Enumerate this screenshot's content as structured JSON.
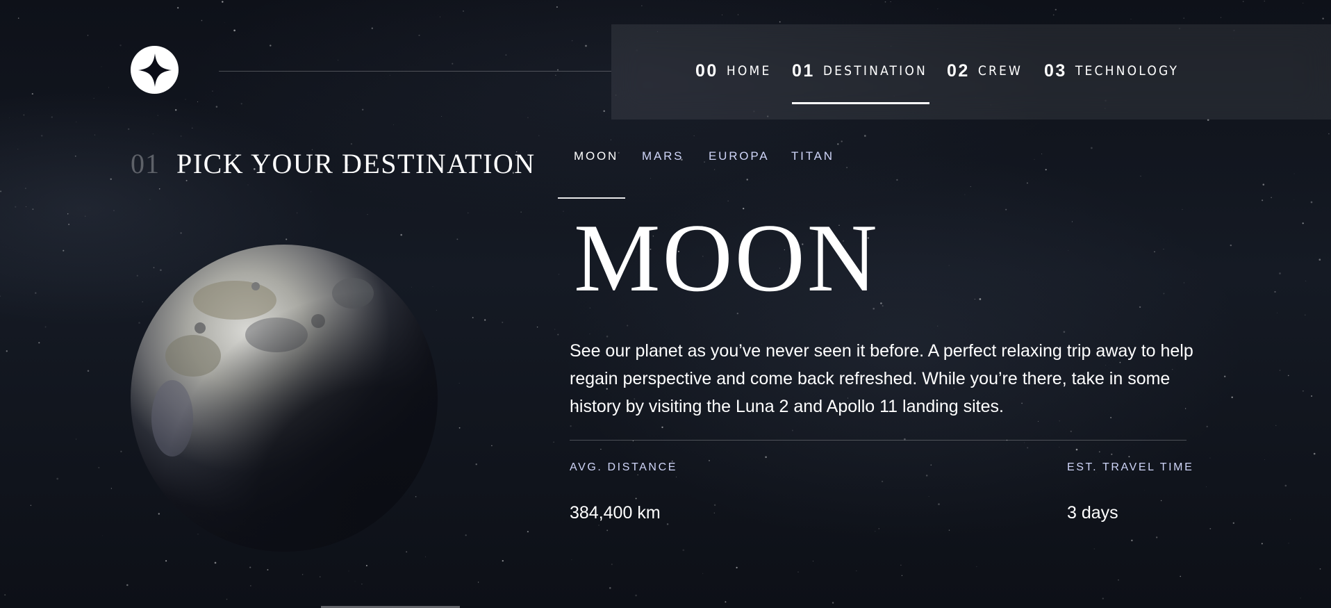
{
  "nav": {
    "items": [
      {
        "num": "00",
        "label": "HOME"
      },
      {
        "num": "01",
        "label": "DESTINATION"
      },
      {
        "num": "02",
        "label": "CREW"
      },
      {
        "num": "03",
        "label": "TECHNOLOGY"
      }
    ],
    "active_index": 1
  },
  "heading": {
    "num": "01",
    "title": "PICK YOUR DESTINATION"
  },
  "tabs": {
    "items": [
      "MOON",
      "MARS",
      "EUROPA",
      "TITAN"
    ],
    "active_index": 0
  },
  "destination": {
    "name": "MOON",
    "description": "See our planet as you’ve never seen it before. A perfect relaxing trip away to help regain perspective and come back refreshed. While you’re there, take in some history by visiting the Luna 2 and Apollo 11 landing sites.",
    "distance_label": "AVG. DISTANCE",
    "distance_value": "384,400 km",
    "travel_label": "EST. TRAVEL TIME",
    "travel_value": "3 days"
  },
  "icons": {
    "logo": "star-logo-icon",
    "planet": "moon-image"
  },
  "colors": {
    "background": "#0b0d17",
    "accent": "#d0d6f9",
    "white": "#ffffff"
  }
}
